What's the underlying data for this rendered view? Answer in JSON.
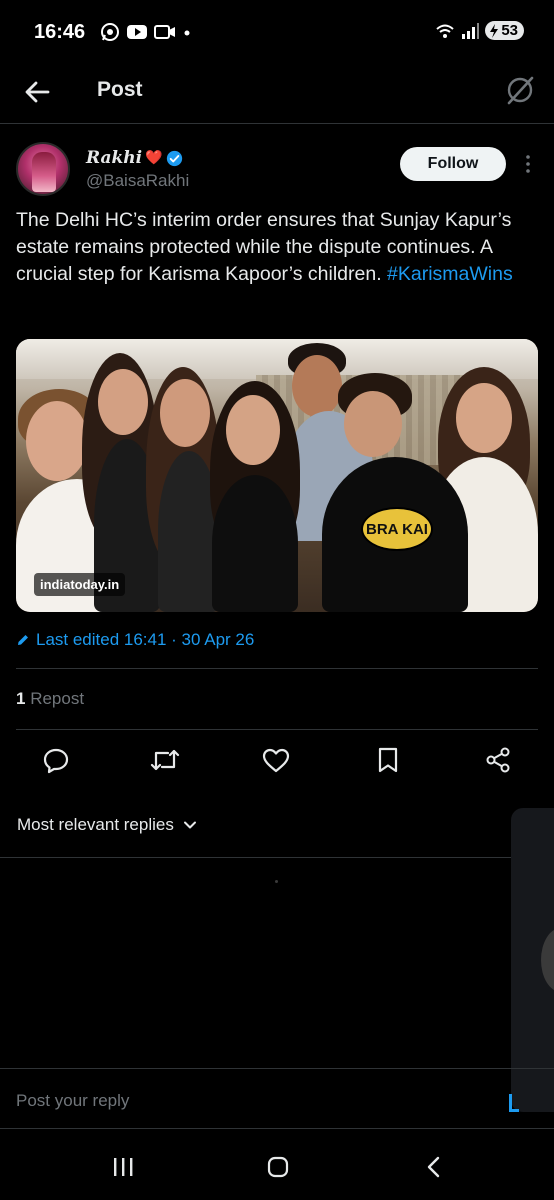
{
  "status_bar": {
    "time": "16:46",
    "battery": "53",
    "app_icons": [
      "whatsapp-icon",
      "youtube-icon",
      "video-icon",
      "dot-icon"
    ],
    "system_icons": [
      "wifi-icon",
      "signal-icon",
      "battery-icon"
    ]
  },
  "topbar": {
    "title": "Post",
    "back_icon": "arrow-left-icon",
    "grok_icon": "grok-icon"
  },
  "post": {
    "author": {
      "display_name": "Rakhi",
      "name_emoji": "❤️",
      "verified": true,
      "handle": "@BaisaRakhi",
      "follow_label": "Follow"
    },
    "text": "The Delhi HC’s interim order ensures that Sunjay Kapur’s estate remains protected while the dispute continues. A crucial step for Karisma Kapoor’s children.",
    "hashtag": "#KarismaWins",
    "image_watermark": "indiatoday.in",
    "shirt_text": "BRA KAI",
    "edited_label": "Last edited 16:41 · 30 Apr 26",
    "repost_count": "1",
    "repost_label": " Repost"
  },
  "actions": [
    "reply-icon",
    "retweet-icon",
    "like-icon",
    "bookmark-icon",
    "share-icon"
  ],
  "replies": {
    "sort_label": "Most relevant replies"
  },
  "reply_bar": {
    "placeholder": "Post your reply"
  },
  "nav_bar": [
    "recents-icon",
    "home-icon",
    "back-icon"
  ],
  "colors": {
    "background": "#000000",
    "text_primary": "#e7e9ea",
    "text_secondary": "#71767b",
    "accent": "#1d9bf0",
    "divider": "#2f3336"
  }
}
